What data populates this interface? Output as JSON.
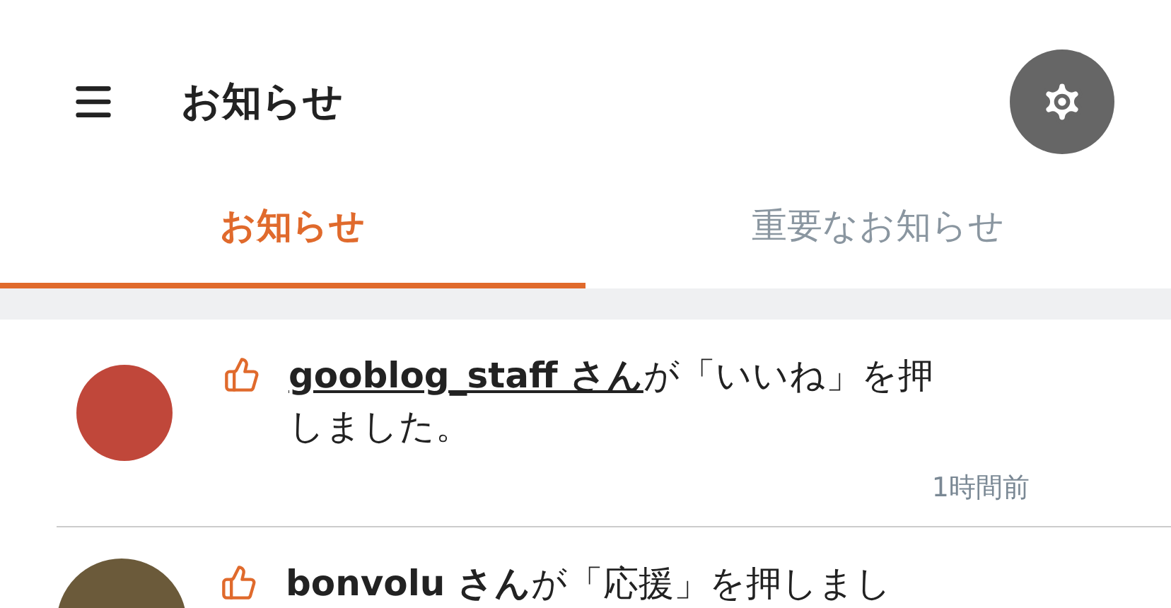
{
  "header": {
    "title": "お知らせ"
  },
  "tabs": [
    {
      "label": "お知らせ",
      "selected": true
    },
    {
      "label": "重要なお知らせ",
      "selected": false
    }
  ],
  "notifications": [
    {
      "kind": "logo",
      "user": "gooblog_staff さん",
      "link": true,
      "message": "が「いいね」を押しました。",
      "time": "1時間前"
    },
    {
      "kind": "photo",
      "user": "bonvolu さん",
      "link": false,
      "message": "が「応援」を押しまし"
    }
  ]
}
